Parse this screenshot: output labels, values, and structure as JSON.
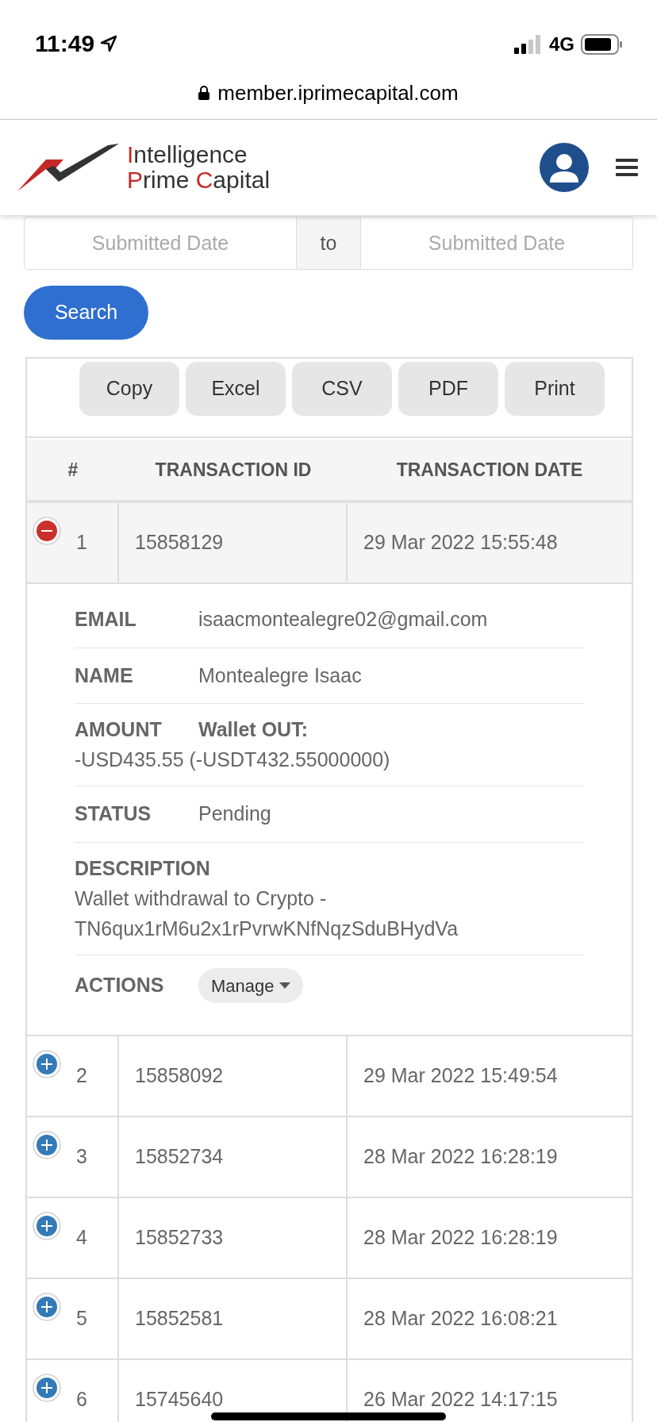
{
  "status_bar": {
    "time": "11:49",
    "network": "4G"
  },
  "address_bar": {
    "url": "member.iprimecapital.com"
  },
  "logo": {
    "lines": [
      [
        {
          "text": "I",
          "accent": true
        },
        {
          "text": "ntelligence",
          "accent": false
        }
      ],
      [
        {
          "text": "P",
          "accent": true
        },
        {
          "text": "rime ",
          "accent": false
        },
        {
          "text": "C",
          "accent": true
        },
        {
          "text": "apital",
          "accent": false
        }
      ]
    ]
  },
  "filter": {
    "from_placeholder": "Submitted Date",
    "separator": "to",
    "to_placeholder": "Submitted Date",
    "search_button": "Search"
  },
  "export_buttons": [
    "Copy",
    "Excel",
    "CSV",
    "PDF",
    "Print"
  ],
  "table": {
    "columns": [
      "#",
      "TRANSACTION ID",
      "TRANSACTION DATE"
    ],
    "rows": [
      {
        "number": "1",
        "id": "15858129",
        "date": "29 Mar 2022 15:55:48",
        "expanded": true,
        "details": [
          {
            "kind": "inline",
            "label": "EMAIL",
            "value": "isaacmontealegre02@gmail.com"
          },
          {
            "kind": "inline",
            "label": "NAME",
            "value": "Montealegre Isaac"
          },
          {
            "kind": "amount",
            "label": "AMOUNT",
            "value_label": "Wallet OUT:",
            "value": "-USD435.55 (-USDT432.55000000)"
          },
          {
            "kind": "inline",
            "label": "STATUS",
            "value": "Pending"
          },
          {
            "kind": "block",
            "label": "DESCRIPTION",
            "value": "Wallet withdrawal to Crypto - TN6qux1rM6u2x1rPvrwKNfNqzSduBHydVa"
          },
          {
            "kind": "menu",
            "label": "ACTIONS",
            "value": "Manage"
          }
        ]
      },
      {
        "number": "2",
        "id": "15858092",
        "date": "29 Mar 2022 15:49:54",
        "expanded": false
      },
      {
        "number": "3",
        "id": "15852734",
        "date": "28 Mar 2022 16:28:19",
        "expanded": false
      },
      {
        "number": "4",
        "id": "15852733",
        "date": "28 Mar 2022 16:28:19",
        "expanded": false
      },
      {
        "number": "5",
        "id": "15852581",
        "date": "28 Mar 2022 16:08:21",
        "expanded": false
      },
      {
        "number": "6",
        "id": "15745640",
        "date": "26 Mar 2022 14:17:15",
        "expanded": false
      }
    ]
  }
}
